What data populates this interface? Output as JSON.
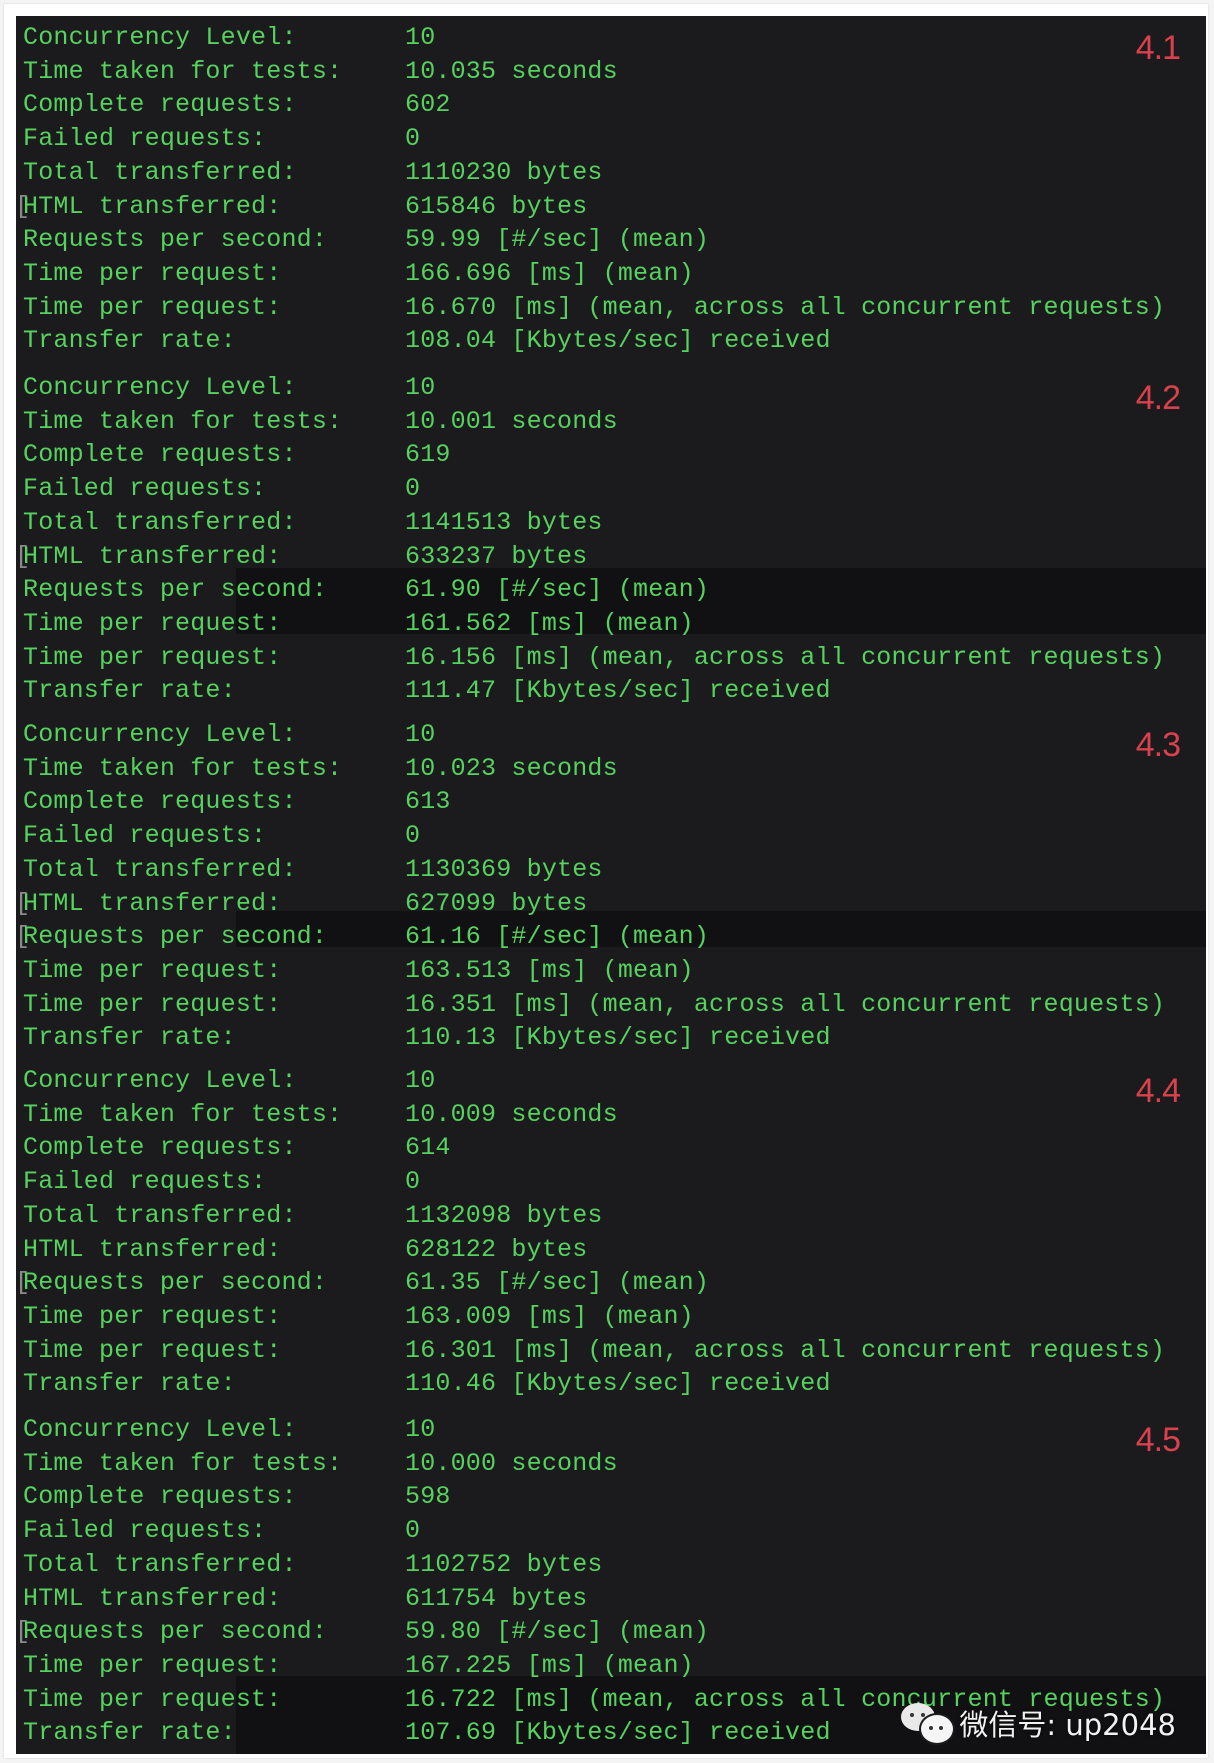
{
  "labels": {
    "concurrency": "Concurrency Level:",
    "time_taken": "Time taken for tests:",
    "complete": "Complete requests:",
    "failed": "Failed requests:",
    "total": "Total transferred:",
    "html": "HTML transferred:",
    "rps": "Requests per second:",
    "tpr": "Time per request:",
    "tpr_all": "Time per request:",
    "rate": "Transfer rate:"
  },
  "runs": [
    {
      "tag": "4.1",
      "concurrency": "10",
      "time_taken": "10.035 seconds",
      "complete": "602",
      "failed": "0",
      "total": "1110230 bytes",
      "html": "615846 bytes",
      "rps": "59.99 [#/sec] (mean)",
      "tpr": "166.696 [ms] (mean)",
      "tpr_all": "16.670 [ms] (mean, across all concurrent requests)",
      "rate": "108.04 [Kbytes/sec] received"
    },
    {
      "tag": "4.2",
      "concurrency": "10",
      "time_taken": "10.001 seconds",
      "complete": "619",
      "failed": "0",
      "total": "1141513 bytes",
      "html": "633237 bytes",
      "rps": "61.90 [#/sec] (mean)",
      "tpr": "161.562 [ms] (mean)",
      "tpr_all": "16.156 [ms] (mean, across all concurrent requests)",
      "rate": "111.47 [Kbytes/sec] received"
    },
    {
      "tag": "4.3",
      "concurrency": "10",
      "time_taken": "10.023 seconds",
      "complete": "613",
      "failed": "0",
      "total": "1130369 bytes",
      "html": "627099 bytes",
      "rps": "61.16 [#/sec] (mean)",
      "tpr": "163.513 [ms] (mean)",
      "tpr_all": "16.351 [ms] (mean, across all concurrent requests)",
      "rate": "110.13 [Kbytes/sec] received"
    },
    {
      "tag": "4.4",
      "concurrency": "10",
      "time_taken": "10.009 seconds",
      "complete": "614",
      "failed": "0",
      "total": "1132098 bytes",
      "html": "628122 bytes",
      "rps": "61.35 [#/sec] (mean)",
      "tpr": "163.009 [ms] (mean)",
      "tpr_all": "16.301 [ms] (mean, across all concurrent requests)",
      "rate": "110.46 [Kbytes/sec] received"
    },
    {
      "tag": "4.5",
      "concurrency": "10",
      "time_taken": "10.000 seconds",
      "complete": "598",
      "failed": "0",
      "total": "1102752 bytes",
      "html": "611754 bytes",
      "rps": "59.80 [#/sec] (mean)",
      "tpr": "167.225 [ms] (mean)",
      "tpr_all": "16.722 [ms] (mean, across all concurrent requests)",
      "rate": "107.69 [Kbytes/sec] received"
    }
  ],
  "watermark": {
    "icon": "wechat-icon",
    "text": "微信号: up2048"
  },
  "colors": {
    "terminal_bg": "#1b1a1d",
    "terminal_text": "#56d25e",
    "tag": "#d9424d"
  }
}
